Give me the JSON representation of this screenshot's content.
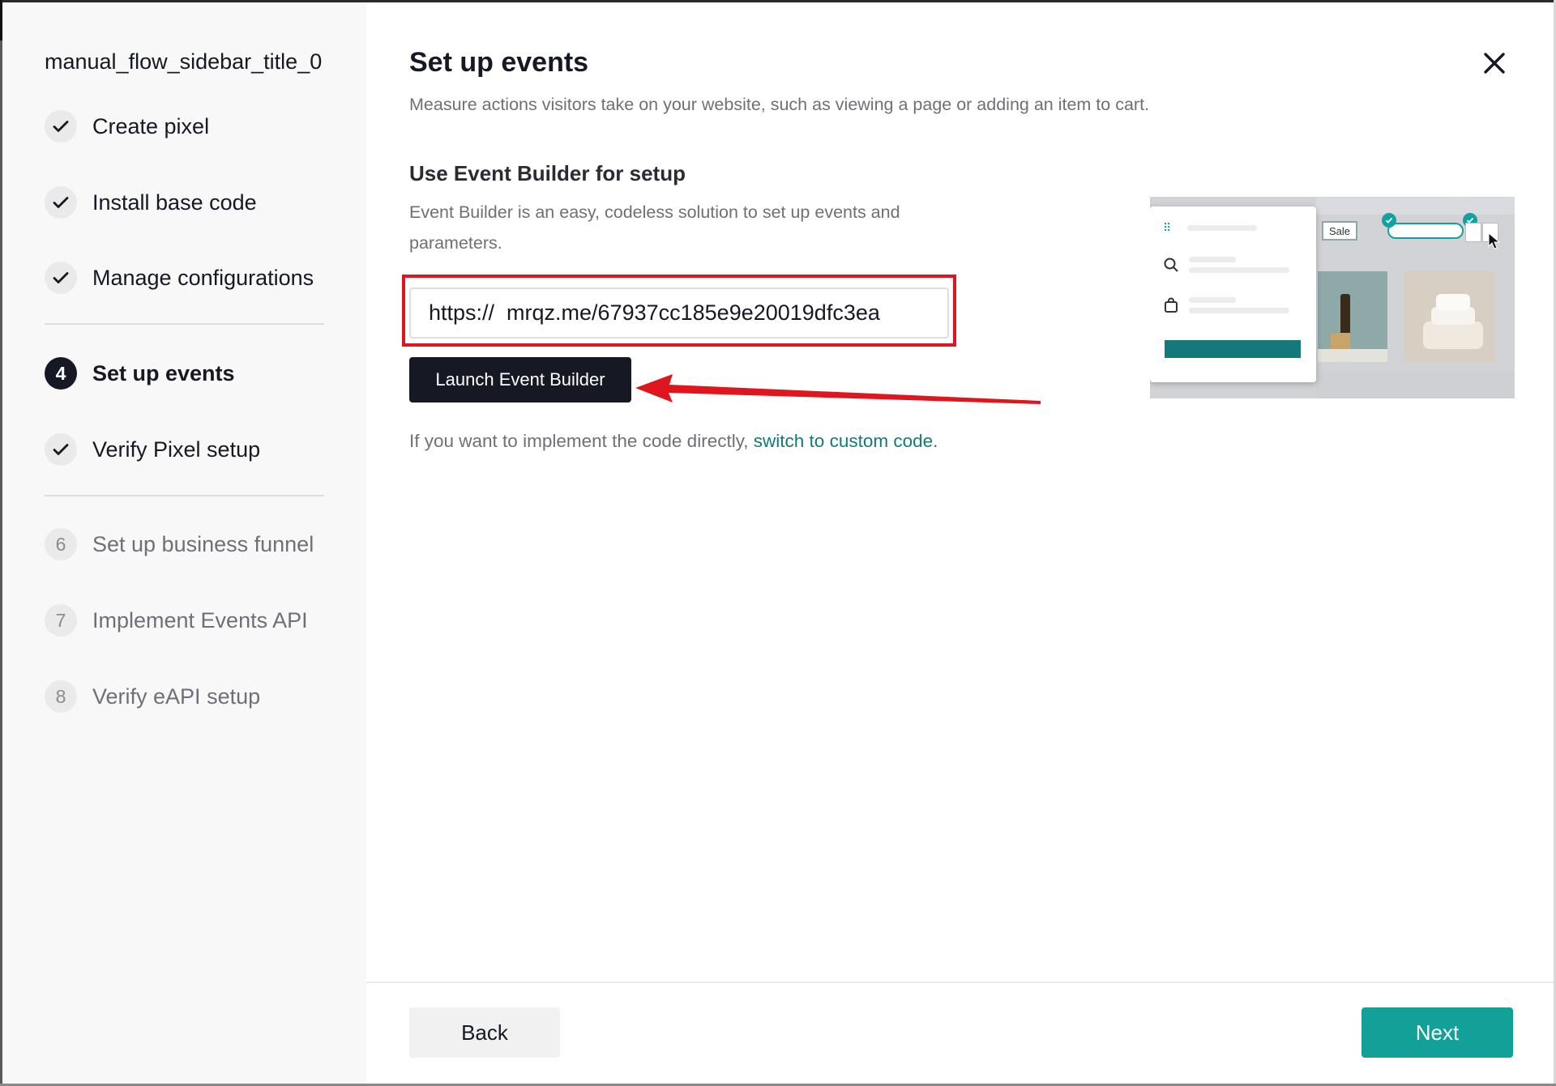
{
  "sidebar": {
    "title": "manual_flow_sidebar_title_0",
    "steps": [
      {
        "label": "Create pixel",
        "state": "done",
        "marker": ""
      },
      {
        "label": "Install base code",
        "state": "done",
        "marker": ""
      },
      {
        "label": "Manage configurations",
        "state": "done",
        "marker": ""
      },
      {
        "label": "Set up events",
        "state": "current",
        "marker": "4"
      },
      {
        "label": "Verify Pixel setup",
        "state": "done",
        "marker": ""
      },
      {
        "label": "Set up business funnel",
        "state": "upcoming",
        "marker": "6"
      },
      {
        "label": "Implement Events API",
        "state": "upcoming",
        "marker": "7"
      },
      {
        "label": "Verify eAPI setup",
        "state": "upcoming",
        "marker": "8"
      }
    ]
  },
  "main": {
    "title": "Set up events",
    "subtitle": "Measure actions visitors take on your website, such as viewing a page or adding an item to cart.",
    "section_title": "Use Event Builder for setup",
    "section_desc": "Event Builder is an easy, codeless solution to set up events and parameters.",
    "url_value": "https://  mrqz.me/67937cc185e9e20019dfc3ea",
    "launch_label": "Launch Event Builder",
    "custom_code_prefix": "If you want to implement the code directly, ",
    "custom_code_link": "switch to custom code."
  },
  "preview": {
    "sale_tag": "Sale"
  },
  "footer": {
    "back_label": "Back",
    "next_label": "Next"
  },
  "colors": {
    "accent": "#13a098",
    "link": "#13797a",
    "highlight": "#e0161f",
    "dark": "#161823"
  }
}
